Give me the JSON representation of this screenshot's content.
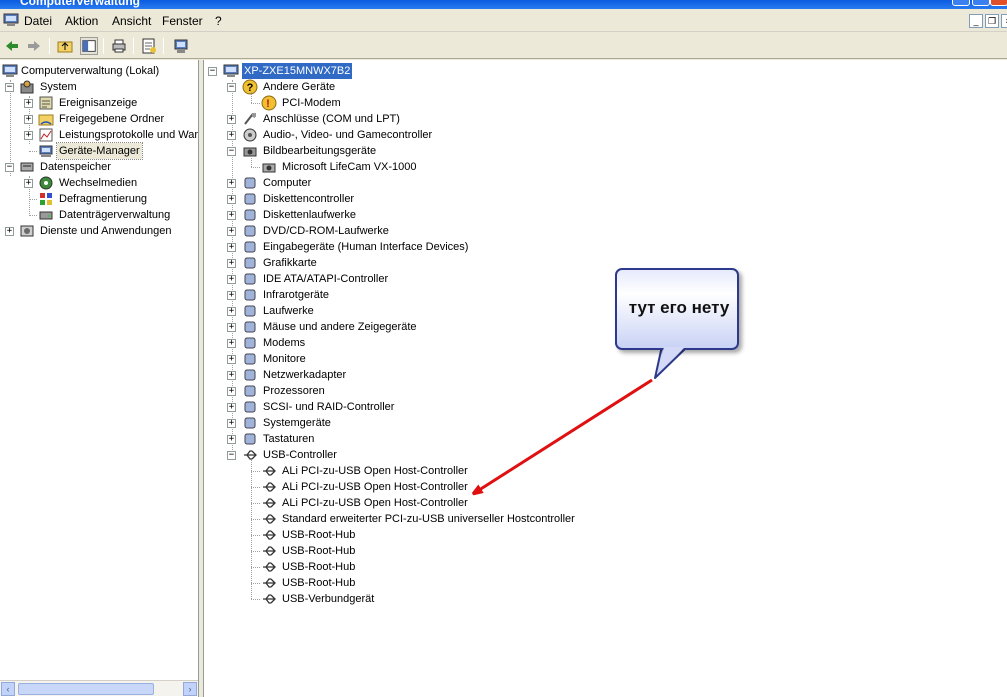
{
  "window": {
    "title": "Computerverwaltung"
  },
  "menu": {
    "items": [
      "Datei",
      "Aktion",
      "Ansicht",
      "Fenster",
      "?"
    ]
  },
  "left_tree": {
    "root": "Computerverwaltung (Lokal)",
    "system": "System",
    "system_children": [
      "Ereignisanzeige",
      "Freigegebene Ordner",
      "Leistungsprotokolle und Warı",
      "Geräte-Manager"
    ],
    "storage": "Datenspeicher",
    "storage_children": [
      "Wechselmedien",
      "Defragmentierung",
      "Datenträgerverwaltung"
    ],
    "services": "Dienste und Anwendungen"
  },
  "device_tree": {
    "computer_name": "XP-ZXE15MNWX7B2",
    "other_devices": "Andere Geräte",
    "other_children": [
      "PCI-Modem"
    ],
    "ports": "Anschlüsse (COM und LPT)",
    "audio": "Audio-, Video- und Gamecontroller",
    "imaging": "Bildbearbeitungsgeräte",
    "imaging_children": [
      "Microsoft LifeCam VX-1000"
    ],
    "categories": [
      "Computer",
      "Diskettencontroller",
      "Diskettenlaufwerke",
      "DVD/CD-ROM-Laufwerke",
      "Eingabegeräte (Human Interface Devices)",
      "Grafikkarte",
      "IDE ATA/ATAPI-Controller",
      "Infrarotgeräte",
      "Laufwerke",
      "Mäuse und andere Zeigegeräte",
      "Modems",
      "Monitore",
      "Netzwerkadapter",
      "Prozessoren",
      "SCSI- und RAID-Controller",
      "Systemgeräte",
      "Tastaturen"
    ],
    "usb": "USB-Controller",
    "usb_children": [
      "ALi PCI-zu-USB Open Host-Controller",
      "ALi PCI-zu-USB Open Host-Controller",
      "ALi PCI-zu-USB Open Host-Controller",
      "Standard erweiterter PCI-zu-USB universeller Hostcontroller",
      "USB-Root-Hub",
      "USB-Root-Hub",
      "USB-Root-Hub",
      "USB-Root-Hub",
      "USB-Verbundgerät"
    ]
  },
  "annotation": {
    "text": "тут его нету",
    "arrow_color": "#e01010"
  },
  "colors": {
    "selection": "#316ac5",
    "titlebar": "#0a5be0"
  }
}
